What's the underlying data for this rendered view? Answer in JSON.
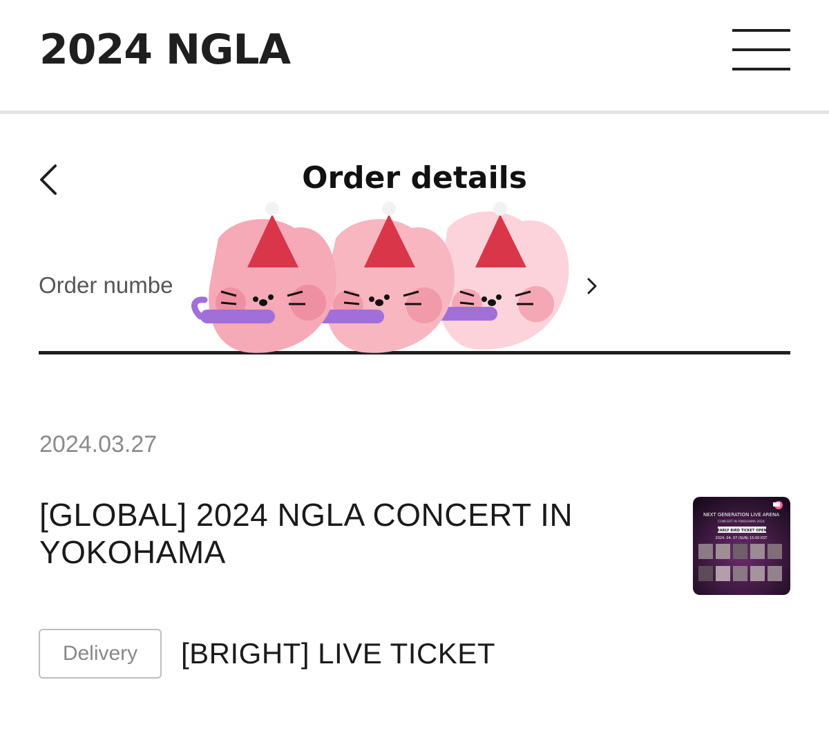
{
  "header": {
    "brand": "2024 NGLA",
    "menu_icon": "hamburger-menu-icon"
  },
  "title_bar": {
    "back_icon": "chevron-left-icon",
    "title": "Order details"
  },
  "order": {
    "number_label": "Order numbe",
    "chevron_icon": "chevron-right-icon",
    "sticker": "three-pink-cats-party-hats-sticker"
  },
  "item": {
    "date": "2024.03.27",
    "title": "[GLOBAL] 2024 NGLA CONCERT IN YOKOHAMA",
    "thumbnail": {
      "heading": "NEXT GENERATION LIVE ARENA",
      "subheading": "CONCERT IN YOKOHAMA 2024",
      "banner": "EARLY BIRD TICKET OPEN",
      "date_line": "2024. 04. 07 (SUN) 15:00 KST"
    },
    "badge": "Delivery",
    "option": "[BRIGHT] LIVE TICKET"
  },
  "colors": {
    "text_dark": "#1a1a1a",
    "text_muted": "#8a8a8a",
    "divider": "#e2e2e2",
    "sticker_pink": "#f6a9b6",
    "sticker_hat": "#d9364a",
    "sticker_purple": "#a070d8",
    "thumb_bg": "#2a1530"
  }
}
